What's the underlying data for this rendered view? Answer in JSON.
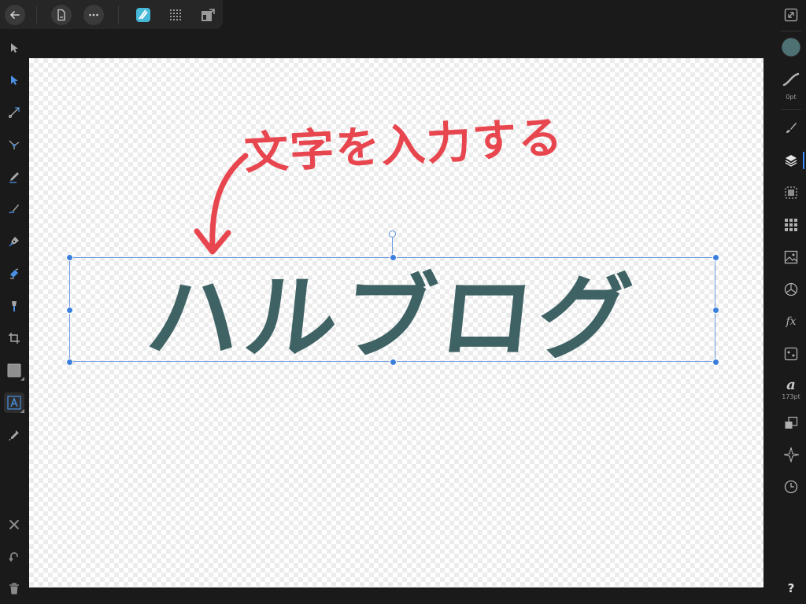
{
  "top_bar": {
    "icons": [
      "back-arrow-icon",
      "document-icon",
      "more-icon",
      "designer-persona-icon",
      "pixel-persona-icon",
      "export-persona-icon"
    ]
  },
  "tools": [
    "move-tool",
    "node-tool",
    "corner-tool",
    "point-transform-tool",
    "pencil-tool",
    "vector-brush-tool",
    "pen-tool",
    "fill-tool",
    "transparency-tool",
    "crop-tool",
    "shape-tool",
    "artistic-text-tool",
    "color-picker-tool"
  ],
  "bottom_tools": [
    "close-icon",
    "undo-icon",
    "trash-icon"
  ],
  "studio": {
    "stroke_label": "0pt",
    "text_size_label": "173pt",
    "text_panel_glyph": "a",
    "fx_glyph": "fx",
    "help_glyph": "?",
    "fill_color": "#4e7274"
  },
  "canvas": {
    "annotation": "文字を入力する",
    "title_text": "ハルブログ",
    "title_color": "#3f6264",
    "annotation_color": "#e8464f"
  }
}
